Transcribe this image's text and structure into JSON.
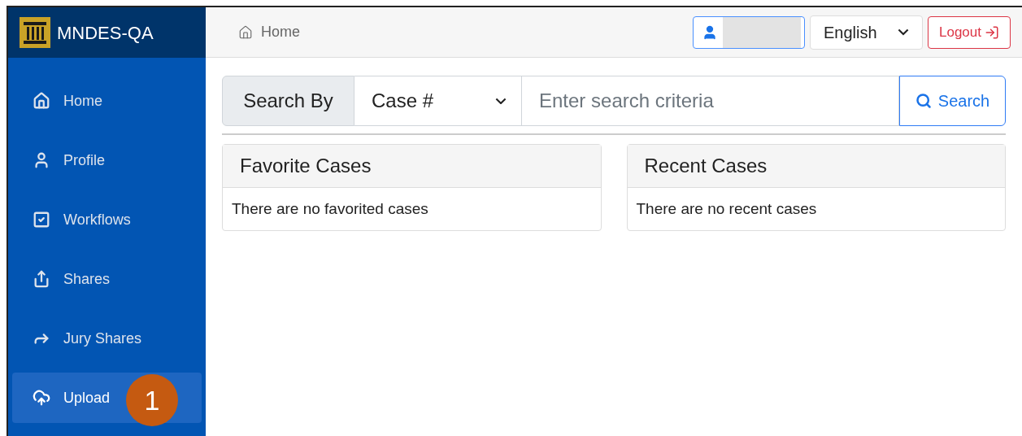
{
  "brand": {
    "title": "MNDES-QA"
  },
  "sidebar": {
    "items": [
      {
        "label": "Home",
        "selected": false
      },
      {
        "label": "Profile",
        "selected": false
      },
      {
        "label": "Workflows",
        "selected": false
      },
      {
        "label": "Shares",
        "selected": false
      },
      {
        "label": "Jury Shares",
        "selected": false
      },
      {
        "label": "Upload",
        "selected": true,
        "callout": "1"
      }
    ]
  },
  "breadcrumb": "Home",
  "header": {
    "language": "English",
    "logout": "Logout"
  },
  "search": {
    "label": "Search By",
    "field": "Case #",
    "placeholder": "Enter search criteria",
    "button": "Search"
  },
  "panels": [
    {
      "title": "Favorite Cases",
      "body": "There are no favorited cases"
    },
    {
      "title": "Recent Cases",
      "body": "There are no recent cases"
    }
  ]
}
